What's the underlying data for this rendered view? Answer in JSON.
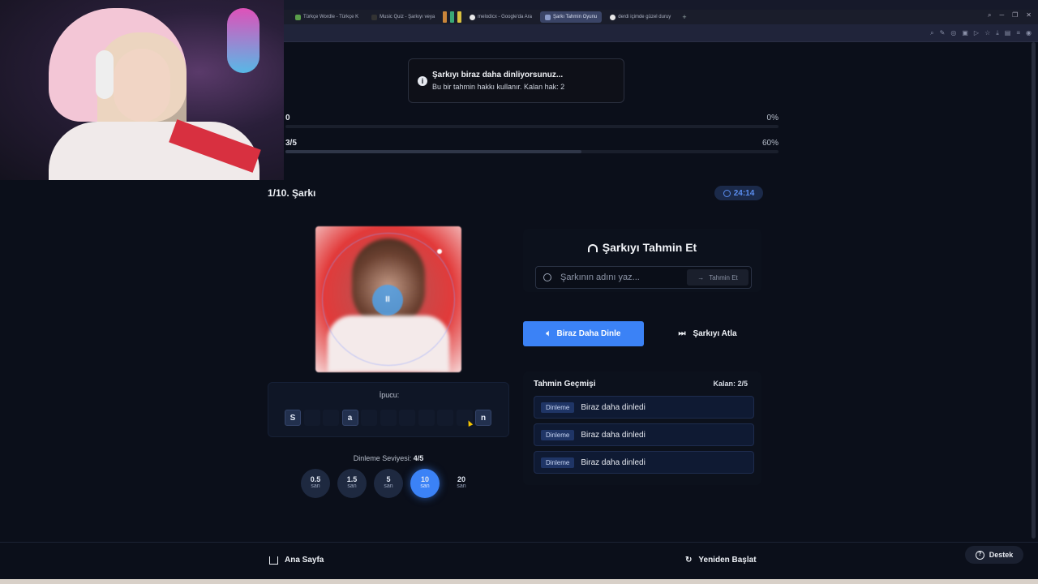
{
  "browser": {
    "tabs": [
      {
        "label": "Türkçe Wordle - Türkçe K",
        "active": false
      },
      {
        "label": "Music Quiz - Şarkıyı veya",
        "active": false
      },
      {
        "label": "melodicx - Google'da Ara",
        "active": false
      },
      {
        "label": "Şarkı Tahmin Oyunu",
        "active": true
      },
      {
        "label": "derdi içimde güzel duruy",
        "active": false
      }
    ],
    "new_tab": "+"
  },
  "toast": {
    "title": "Şarkıyı biraz daha dinliyorsunuz...",
    "message": "Bu bir tahmin hakkı kullanır. Kalan hak: 2"
  },
  "progress": [
    {
      "label": "0",
      "percent_text": "0%",
      "fraction": 0.0
    },
    {
      "label": "3/5",
      "percent_text": "60%",
      "fraction": 0.6
    }
  ],
  "song_counter": "1/10. Şarkı",
  "timer": "24:14",
  "player": {
    "pause_glyph": "II"
  },
  "hint": {
    "label": "İpucu:",
    "letters": [
      "S",
      "",
      "",
      "a",
      "",
      "",
      "",
      "",
      "",
      "",
      "n"
    ]
  },
  "level": {
    "label": "Dinleme Seviyesi:",
    "value": "4/5",
    "options": [
      {
        "value": "0.5",
        "unit": "san"
      },
      {
        "value": "1.5",
        "unit": "san"
      },
      {
        "value": "5",
        "unit": "san"
      },
      {
        "value": "10",
        "unit": "san"
      },
      {
        "value": "20",
        "unit": "san"
      }
    ],
    "active_index": 3
  },
  "guess": {
    "title": "Şarkıyı Tahmin Et",
    "placeholder": "Şarkının adını yaz...",
    "submit": "Tahmin Et"
  },
  "actions": {
    "listen_more": "Biraz Daha Dinle",
    "skip": "Şarkıyı Atla"
  },
  "history": {
    "title": "Tahmin Geçmişi",
    "remaining": "Kalan: 2/5",
    "items": [
      {
        "badge": "Dinleme",
        "text": "Biraz daha dinledi"
      },
      {
        "badge": "Dinleme",
        "text": "Biraz daha dinledi"
      },
      {
        "badge": "Dinleme",
        "text": "Biraz daha dinledi"
      }
    ]
  },
  "footer": {
    "home": "Ana Sayfa",
    "restart": "Yeniden Başlat",
    "support": "Destek"
  },
  "colors": {
    "accent": "#3b82f6",
    "background": "#0b0f1a"
  }
}
